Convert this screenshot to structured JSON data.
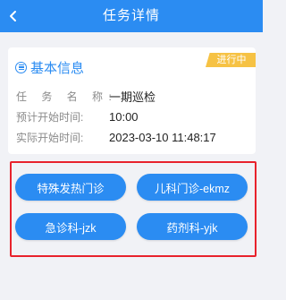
{
  "header": {
    "title": "任务详情",
    "back_icon": "chevron-left-icon"
  },
  "card": {
    "section_title": "基本信息",
    "section_icon": "list-icon",
    "status_badge": "进行中",
    "fields": [
      {
        "label": "任 务 名 称:",
        "value": "一期巡检"
      },
      {
        "label": "预计开始时间:",
        "value": "10:00"
      },
      {
        "label": "实际开始时间:",
        "value": "2023-03-10 11:48:17"
      }
    ]
  },
  "departments": [
    {
      "label": "特殊发热门诊"
    },
    {
      "label": "儿科门诊-ekmz"
    },
    {
      "label": "急诊科-jzk"
    },
    {
      "label": "药剂科-yjk"
    }
  ],
  "colors": {
    "primary": "#2b8cf2",
    "badge": "#f6c244",
    "highlight": "#e8222c"
  }
}
